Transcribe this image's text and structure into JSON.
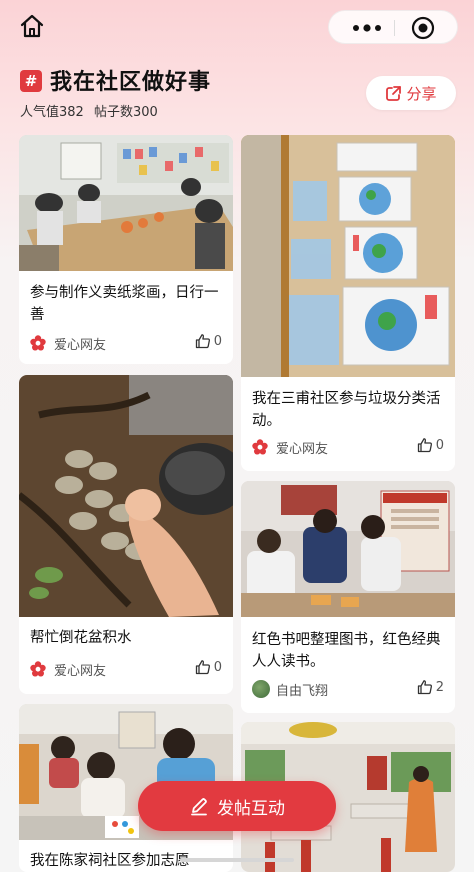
{
  "topbar": {
    "home_icon": "home-icon",
    "more_icon": "more-dots-icon",
    "target_icon": "target-circle-icon"
  },
  "header": {
    "hash": "#",
    "title": "我在社区做好事",
    "popularity": "人气值382",
    "post_count": "帖子数300",
    "share_label": "分享"
  },
  "posts": [
    {
      "title": "参与制作义卖纸浆画，日行一善",
      "author": "爱心网友",
      "likes": "0",
      "avatar": "flower-icon"
    },
    {
      "title": "我在三甫社区参与垃圾分类活动。",
      "author": "爱心网友",
      "likes": "0",
      "avatar": "flower-icon"
    },
    {
      "title": "帮忙倒花盆积水",
      "author": "爱心网友",
      "likes": "0",
      "avatar": "flower-icon"
    },
    {
      "title": "红色书吧整理图书，红色经典人人读书。",
      "author": "自由飞翔",
      "likes": "2",
      "avatar": "user-photo"
    },
    {
      "title": "我在陈家祠社区参加志愿",
      "author": "",
      "likes": "",
      "avatar": ""
    },
    {
      "title": "",
      "author": "",
      "likes": "",
      "avatar": ""
    }
  ],
  "fab": {
    "label": "发帖互动",
    "icon": "pen-icon"
  },
  "colors": {
    "accent": "#e23a40",
    "background_top": "#fbd3d6",
    "card": "#ffffff"
  }
}
